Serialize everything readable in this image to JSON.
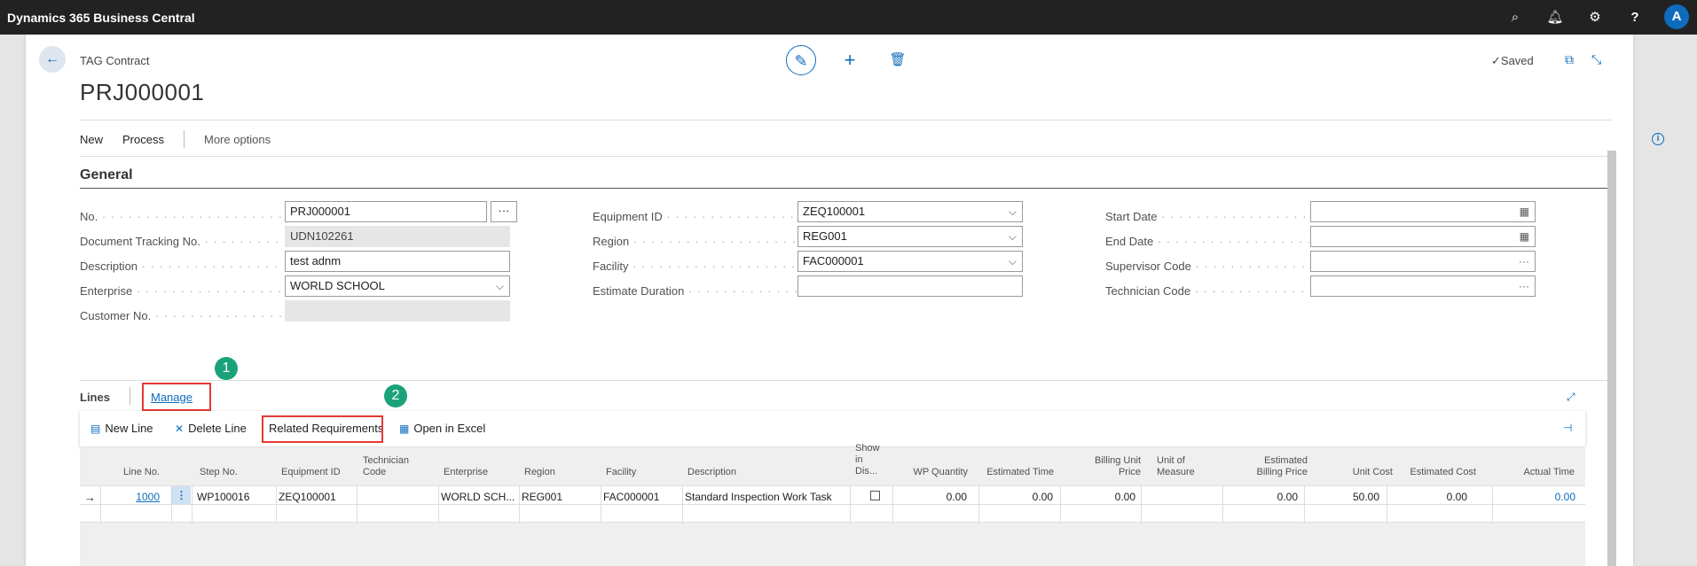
{
  "app": {
    "title": "Dynamics 365 Business Central",
    "user_initial": "A"
  },
  "header": {
    "caption": "TAG Contract",
    "title": "PRJ000001",
    "status": "Saved"
  },
  "actions": [
    "New",
    "Process",
    "More options"
  ],
  "general": {
    "section_title": "General",
    "col1": [
      {
        "label": "No.",
        "value": "PRJ000001"
      },
      {
        "label": "Document Tracking No.",
        "value": "UDN102261"
      },
      {
        "label": "Description",
        "value": "test adnm"
      },
      {
        "label": "Enterprise",
        "value": "WORLD SCHOOL"
      },
      {
        "label": "Customer No.",
        "value": ""
      }
    ],
    "col2": [
      {
        "label": "Equipment ID",
        "value": "ZEQ100001"
      },
      {
        "label": "Region",
        "value": "REG001"
      },
      {
        "label": "Facility",
        "value": "FAC000001"
      },
      {
        "label": "Estimate Duration",
        "value": ""
      }
    ],
    "col3": [
      {
        "label": "Start Date",
        "value": ""
      },
      {
        "label": "End Date",
        "value": ""
      },
      {
        "label": "Supervisor Code",
        "value": ""
      },
      {
        "label": "Technician Code",
        "value": ""
      }
    ]
  },
  "lines": {
    "title": "Lines",
    "manage": "Manage",
    "badges": [
      "1",
      "2"
    ],
    "toolbar": {
      "new_line": "New Line",
      "delete_line": "Delete Line",
      "related": "Related Requirements",
      "open_excel": "Open in Excel"
    },
    "columns": [
      "Line No.",
      "Step No.",
      "Equipment ID",
      "Technician Code",
      "Enterprise",
      "Region",
      "Facility",
      "Description",
      "Show in Dis...",
      "WP Quantity",
      "Estimated Time",
      "Billing Unit Price",
      "Unit of Measure",
      "Estimated Billing Price",
      "Unit Cost",
      "Estimated Cost",
      "Actual Time"
    ],
    "row": {
      "line_no": "1000",
      "step_no": "WP100016",
      "equipment_id": "ZEQ100001",
      "technician_code": "",
      "enterprise": "WORLD SCH...",
      "region": "REG001",
      "facility": "FAC000001",
      "description": "Standard Inspection Work Task",
      "show_in_display": false,
      "wp_quantity": "0.00",
      "estimated_time": "0.00",
      "billing_unit_price": "0.00",
      "unit_of_measure": "",
      "estimated_billing_price": "0.00",
      "unit_cost": "50.00",
      "estimated_cost": "0.00",
      "actual_time": "0.00"
    }
  },
  "colors": {
    "accent": "#0f6cbd",
    "highlight_box": "#e53935",
    "badge": "#1aa37a"
  }
}
